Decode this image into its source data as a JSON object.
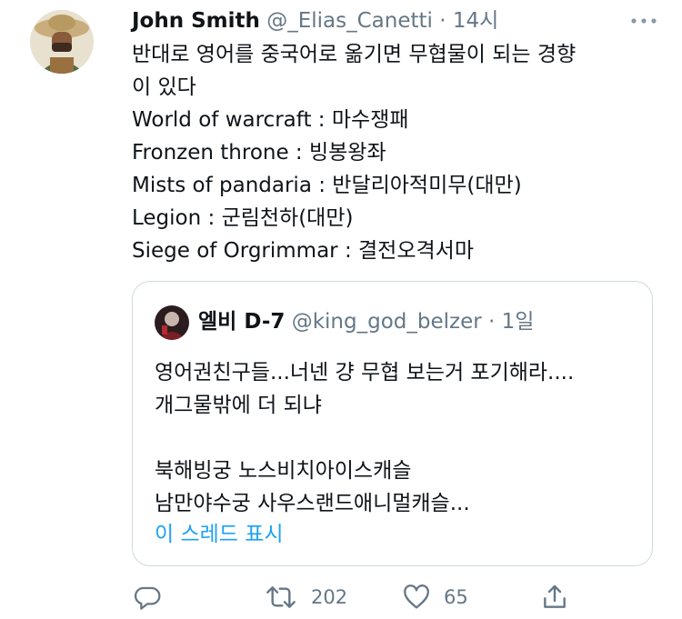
{
  "tweet": {
    "author_name": "John Smith",
    "author_handle": "@_Elias_Canetti",
    "separator": "·",
    "time": "14시",
    "lines": [
      "반대로 영어를 중국어로 옮기면 무협물이 되는 경향",
      "이 있다",
      "World of warcraft : 마수쟁패",
      "Fronzen throne : 빙봉왕좌",
      "Mists of pandaria : 반달리아적미무(대만)",
      "Legion : 군림천하(대만)",
      "Siege of Orgrimmar : 결전오격서마"
    ]
  },
  "quote": {
    "author_name": "엘비 D-7",
    "author_handle": "@king_god_belzer",
    "separator": "·",
    "time": "1일",
    "lines": [
      "영어권친구들...너넨 걍 무협 보는거 포기해라....",
      "개그물밖에 더 되냐",
      "",
      "북해빙궁 노스비치아이스캐슬",
      "남만야수궁 사우스랜드애니멀캐슬..."
    ],
    "show_thread": "이 스레드 표시"
  },
  "actions": {
    "reply_icon": "reply-icon",
    "retweet_icon": "retweet-icon",
    "retweet_count": "202",
    "like_icon": "heart-icon",
    "like_count": "65",
    "share_icon": "share-icon"
  },
  "colors": {
    "text": "#0f1419",
    "secondary": "#657786",
    "link": "#1da1f2",
    "border": "#cfd9de"
  }
}
